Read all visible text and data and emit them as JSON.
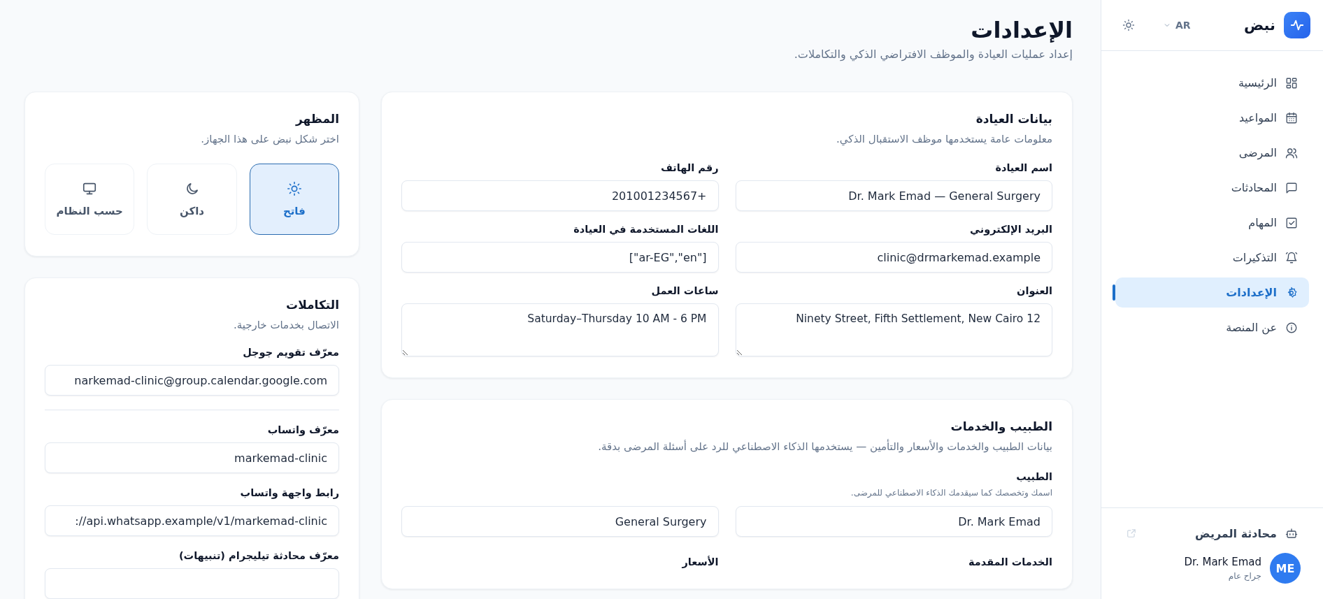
{
  "sidebar": {
    "brand": "نبض",
    "language": "AR",
    "nav": [
      {
        "label": "الرئيسية",
        "selected": false
      },
      {
        "label": "المواعيد",
        "selected": false
      },
      {
        "label": "المرضى",
        "selected": false
      },
      {
        "label": "المحادثات",
        "selected": false
      },
      {
        "label": "المهام",
        "selected": false
      },
      {
        "label": "التذكيرات",
        "selected": false
      },
      {
        "label": "الإعدادات",
        "selected": true
      },
      {
        "label": "عن المنصة",
        "selected": false
      }
    ],
    "patient_chat": "محادثة المريض",
    "user": {
      "initials": "ME",
      "name": "Dr. Mark Emad",
      "role": "جراح عام"
    }
  },
  "header": {
    "title": "الإعدادات",
    "subtitle": "إعداد عمليات العيادة والموظف الافتراضي الذكي والتكاملات."
  },
  "clinic": {
    "title": "بيانات العيادة",
    "subtitle": "معلومات عامة يستخدمها موظف الاستقبال الذكي.",
    "fields": [
      {
        "label": "اسم العيادة",
        "kind": "input",
        "value": "Dr. Mark Emad — General Surgery"
      },
      {
        "label": "رقم الهاتف",
        "kind": "input",
        "value": "+201001234567"
      },
      {
        "label": "البريد الإلكتروني",
        "kind": "input",
        "value": "clinic@drmarkemad.example"
      },
      {
        "label": "اللغات المستخدمة في العيادة",
        "kind": "input",
        "value": "[\"ar-EG\",\"en\"]"
      },
      {
        "label": "العنوان",
        "kind": "textarea",
        "value": "Ninety Street, Fifth Settlement, New Cairo 12"
      },
      {
        "label": "ساعات العمل",
        "kind": "textarea",
        "value": "Saturday–Thursday 10 AM - 6 PM"
      }
    ]
  },
  "doctor": {
    "title": "الطبيب والخدمات",
    "subtitle": "بيانات الطبيب والخدمات والأسعار والتأمين — يستخدمها الذكاء الاصطناعي للرد على أسئلة المرضى بدقة.",
    "doctor_label": "الطبيب",
    "doctor_hint": "اسمك وتخصصك كما سيقدمك الذكاء الاصطناعي للمرضى.",
    "doctor_values": [
      "Dr. Mark Emad",
      "General Surgery"
    ],
    "more_labels": [
      "الخدمات المقدمة",
      "الأسعار"
    ]
  },
  "appearance": {
    "title": "المظهر",
    "subtitle": "اختر شكل نبض على هذا الجهاز.",
    "options": [
      {
        "label": "فاتح",
        "kind": "light",
        "selected": true
      },
      {
        "label": "داكن",
        "kind": "dark",
        "selected": false
      },
      {
        "label": "حسب النظام",
        "kind": "system",
        "selected": false
      }
    ]
  },
  "integrations": {
    "title": "التكاملات",
    "subtitle": "الاتصال بخدمات خارجية.",
    "groups": [
      [
        {
          "label": "معرّف تقويم جوجل",
          "value": "narkemad-clinic@group.calendar.google.com"
        }
      ],
      [
        {
          "label": "معرّف واتساب",
          "value": "markemad-clinic"
        },
        {
          "label": "رابط واجهة واتساب",
          "value": "://api.whatsapp.example/v1/markemad-clinic"
        },
        {
          "label": "معرّف محادثة تيليجرام (تنبيهات)"
        }
      ]
    ]
  }
}
